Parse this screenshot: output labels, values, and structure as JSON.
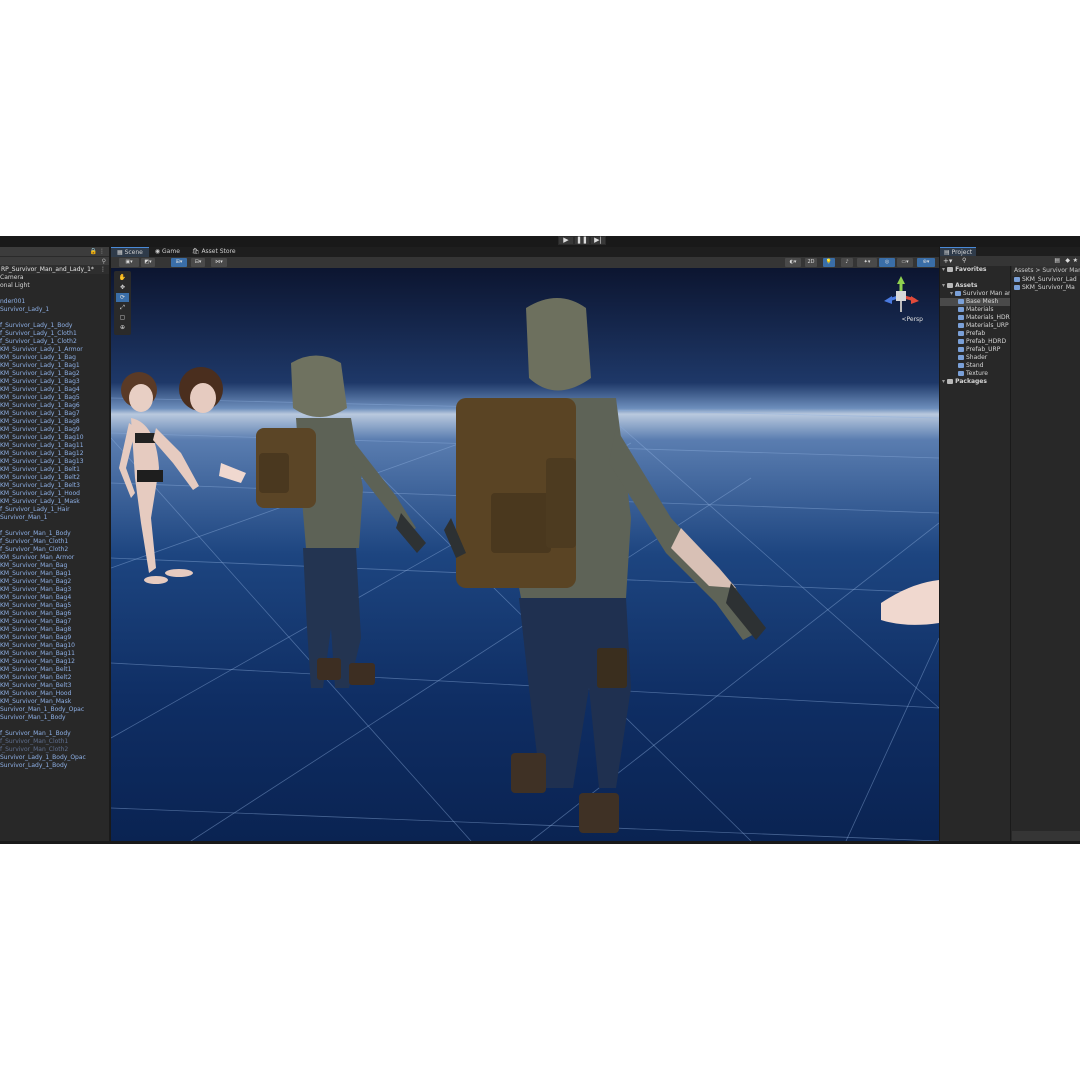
{
  "toolbar": {
    "play": "▶",
    "pause": "❚❚",
    "step": "▶|"
  },
  "hierarchy": {
    "scene_name": "RP_Survivor_Man_and_Lady_1*",
    "rows": [
      {
        "label": "Camera",
        "style": "plain"
      },
      {
        "label": "onal Light",
        "style": "plain"
      },
      {
        "label": "",
        "style": "gap"
      },
      {
        "label": "nder001",
        "style": "blue"
      },
      {
        "label": "Survivor_Lady_1",
        "style": "blue"
      },
      {
        "label": "",
        "style": "gap"
      },
      {
        "label": "f_Survivor_Lady_1_Body",
        "style": "blue"
      },
      {
        "label": "f_Survivor_Lady_1_Cloth1",
        "style": "blue"
      },
      {
        "label": "f_Survivor_Lady_1_Cloth2",
        "style": "blue"
      },
      {
        "label": "KM_Survivor_Lady_1_Armor",
        "style": "blue"
      },
      {
        "label": "KM_Survivor_Lady_1_Bag",
        "style": "blue"
      },
      {
        "label": "KM_Survivor_Lady_1_Bag1",
        "style": "blue"
      },
      {
        "label": "KM_Survivor_Lady_1_Bag2",
        "style": "blue"
      },
      {
        "label": "KM_Survivor_Lady_1_Bag3",
        "style": "blue"
      },
      {
        "label": "KM_Survivor_Lady_1_Bag4",
        "style": "blue"
      },
      {
        "label": "KM_Survivor_Lady_1_Bag5",
        "style": "blue"
      },
      {
        "label": "KM_Survivor_Lady_1_Bag6",
        "style": "blue"
      },
      {
        "label": "KM_Survivor_Lady_1_Bag7",
        "style": "blue"
      },
      {
        "label": "KM_Survivor_Lady_1_Bag8",
        "style": "blue"
      },
      {
        "label": "KM_Survivor_Lady_1_Bag9",
        "style": "blue"
      },
      {
        "label": "KM_Survivor_Lady_1_Bag10",
        "style": "blue"
      },
      {
        "label": "KM_Survivor_Lady_1_Bag11",
        "style": "blue"
      },
      {
        "label": "KM_Survivor_Lady_1_Bag12",
        "style": "blue"
      },
      {
        "label": "KM_Survivor_Lady_1_Bag13",
        "style": "blue"
      },
      {
        "label": "KM_Survivor_Lady_1_Belt1",
        "style": "blue"
      },
      {
        "label": "KM_Survivor_Lady_1_Belt2",
        "style": "blue"
      },
      {
        "label": "KM_Survivor_Lady_1_Belt3",
        "style": "blue"
      },
      {
        "label": "KM_Survivor_Lady_1_Hood",
        "style": "blue"
      },
      {
        "label": "KM_Survivor_Lady_1_Mask",
        "style": "blue"
      },
      {
        "label": "f_Survivor_Lady_1_Hair",
        "style": "blue"
      },
      {
        "label": "Survivor_Man_1",
        "style": "blue"
      },
      {
        "label": "",
        "style": "gap"
      },
      {
        "label": "f_Survivor_Man_1_Body",
        "style": "blue"
      },
      {
        "label": "f_Survivor_Man_Cloth1",
        "style": "blue"
      },
      {
        "label": "f_Survivor_Man_Cloth2",
        "style": "blue"
      },
      {
        "label": "KM_Survivor_Man_Armor",
        "style": "blue"
      },
      {
        "label": "KM_Survivor_Man_Bag",
        "style": "blue"
      },
      {
        "label": "KM_Survivor_Man_Bag1",
        "style": "blue"
      },
      {
        "label": "KM_Survivor_Man_Bag2",
        "style": "blue"
      },
      {
        "label": "KM_Survivor_Man_Bag3",
        "style": "blue"
      },
      {
        "label": "KM_Survivor_Man_Bag4",
        "style": "blue"
      },
      {
        "label": "KM_Survivor_Man_Bag5",
        "style": "blue"
      },
      {
        "label": "KM_Survivor_Man_Bag6",
        "style": "blue"
      },
      {
        "label": "KM_Survivor_Man_Bag7",
        "style": "blue"
      },
      {
        "label": "KM_Survivor_Man_Bag8",
        "style": "blue"
      },
      {
        "label": "KM_Survivor_Man_Bag9",
        "style": "blue"
      },
      {
        "label": "KM_Survivor_Man_Bag10",
        "style": "blue"
      },
      {
        "label": "KM_Survivor_Man_Bag11",
        "style": "blue"
      },
      {
        "label": "KM_Survivor_Man_Bag12",
        "style": "blue"
      },
      {
        "label": "KM_Survivor_Man_Belt1",
        "style": "blue"
      },
      {
        "label": "KM_Survivor_Man_Belt2",
        "style": "blue"
      },
      {
        "label": "KM_Survivor_Man_Belt3",
        "style": "blue"
      },
      {
        "label": "KM_Survivor_Man_Hood",
        "style": "blue"
      },
      {
        "label": "KM_Survivor_Man_Mask",
        "style": "blue"
      },
      {
        "label": "Survivor_Man_1_Body_Opac",
        "style": "blue"
      },
      {
        "label": "Survivor_Man_1_Body",
        "style": "blue"
      },
      {
        "label": "",
        "style": "gap"
      },
      {
        "label": "f_Survivor_Man_1_Body",
        "style": "blue"
      },
      {
        "label": "f_Survivor_Man_Cloth1",
        "style": "dim"
      },
      {
        "label": "f_Survivor_Man_Cloth2",
        "style": "dim"
      },
      {
        "label": "Survivor_Lady_1_Body_Opac",
        "style": "blue"
      },
      {
        "label": "Survivor_Lady_1_Body",
        "style": "blue"
      }
    ]
  },
  "scene": {
    "tabs": [
      "Scene",
      "Game",
      "Asset Store"
    ],
    "view_label": "2D",
    "persp_label": "<Persp"
  },
  "project": {
    "tab": "Project",
    "tree": [
      {
        "label": "Favorites",
        "kind": "bold"
      },
      {
        "label": "",
        "kind": "gap"
      },
      {
        "label": "Assets",
        "kind": "bold"
      },
      {
        "label": "Survivor Man and",
        "kind": "folder"
      },
      {
        "label": "Base Mesh",
        "kind": "sel"
      },
      {
        "label": "Materials",
        "kind": "sub"
      },
      {
        "label": "Materials_HDR",
        "kind": "sub"
      },
      {
        "label": "Materials_URP",
        "kind": "sub"
      },
      {
        "label": "Prefab",
        "kind": "sub"
      },
      {
        "label": "Prefab_HDRD",
        "kind": "sub"
      },
      {
        "label": "Prefab_URP",
        "kind": "sub"
      },
      {
        "label": "Shader",
        "kind": "sub"
      },
      {
        "label": "Stand",
        "kind": "sub"
      },
      {
        "label": "Texture",
        "kind": "sub"
      },
      {
        "label": "Packages",
        "kind": "bold"
      }
    ],
    "breadcrumb": "Assets > Survivor Man",
    "items": [
      "SKM_Survivor_Lad",
      "SKM_Survivor_Ma"
    ]
  }
}
